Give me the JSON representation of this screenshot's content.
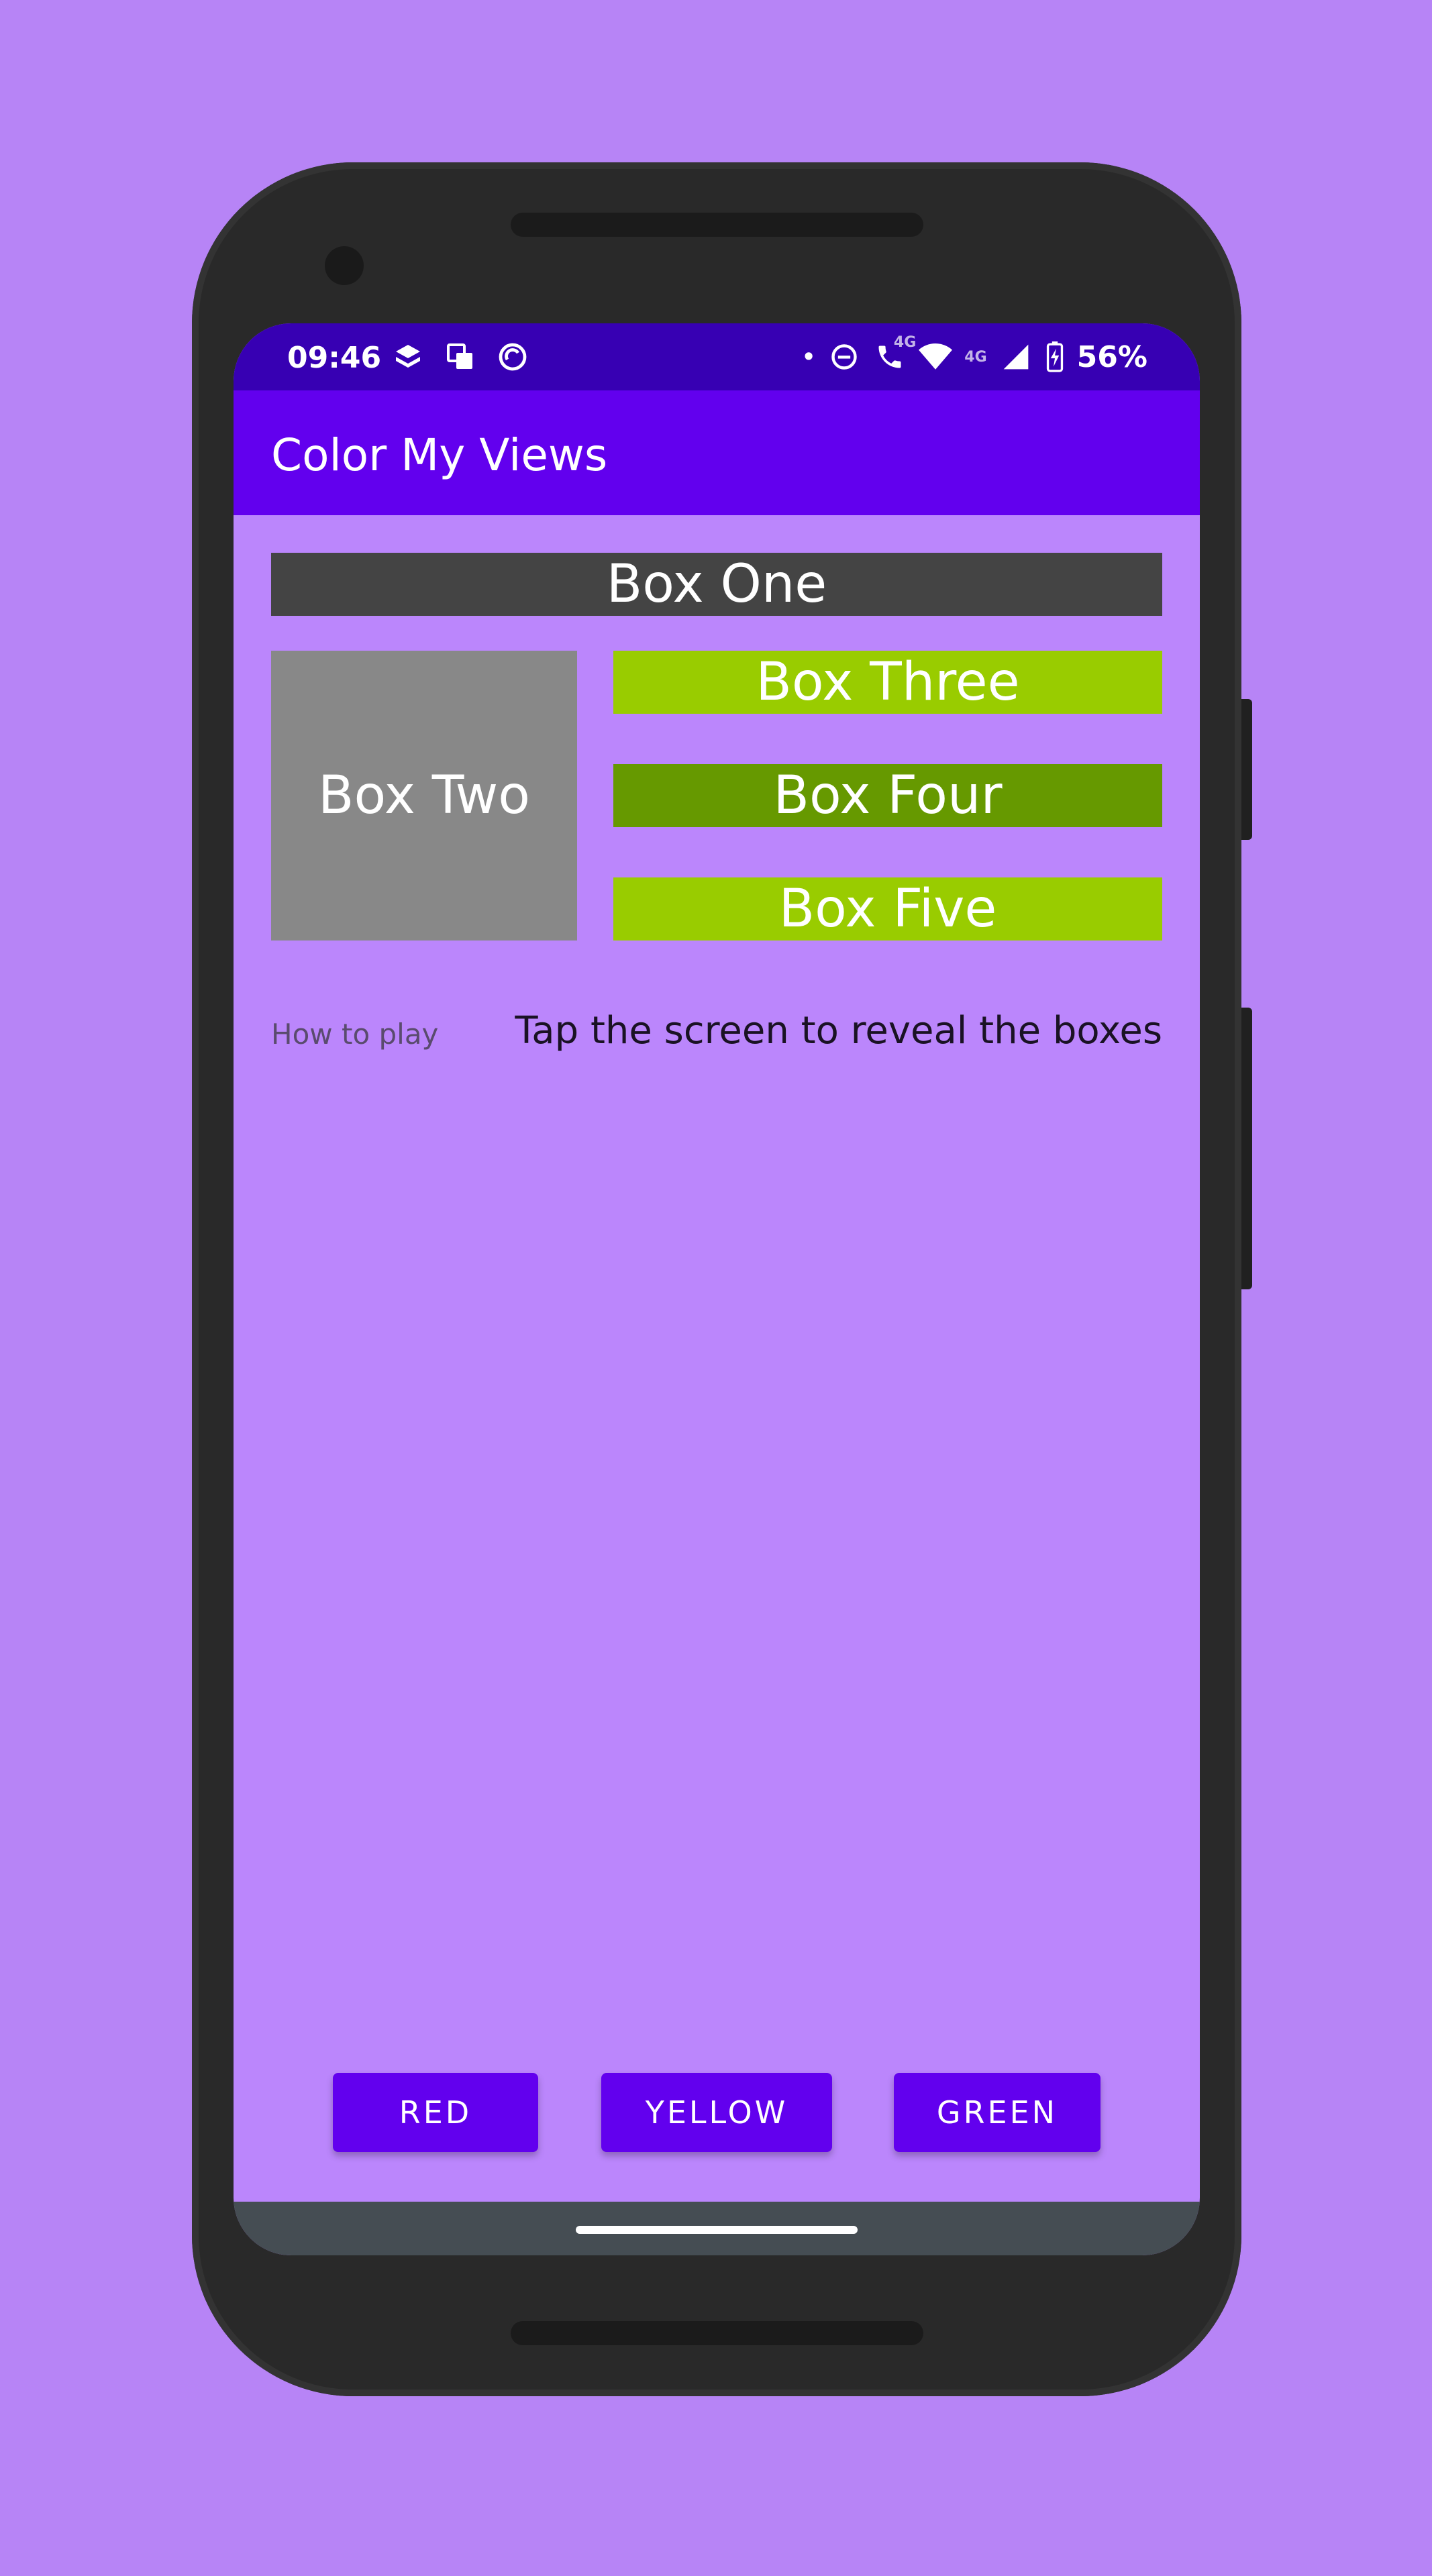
{
  "status_bar": {
    "time": "09:46",
    "left_icons": [
      "layers-icon",
      "translate-icon",
      "sync-icon"
    ],
    "dot": "•",
    "battery": "56%",
    "network_small": "4G",
    "call_lte": "4G"
  },
  "app_bar": {
    "title": "Color My Views"
  },
  "boxes": {
    "one": "Box One",
    "two": "Box Two",
    "three": "Box Three",
    "four": "Box Four",
    "five": "Box Five"
  },
  "instructions": {
    "label": "How to play",
    "text": "Tap the screen to reveal the boxes"
  },
  "buttons": {
    "red": "RED",
    "yellow": "YELLOW",
    "green": "GREEN"
  },
  "colors": {
    "background": "#b784f6",
    "screen": "#bb86fc",
    "app_bar": "#6200ee",
    "status_bar": "#3700b3",
    "box_one": "#444444",
    "box_two": "#888888",
    "box_green_light": "#99cc00",
    "box_green_dark": "#669900"
  }
}
